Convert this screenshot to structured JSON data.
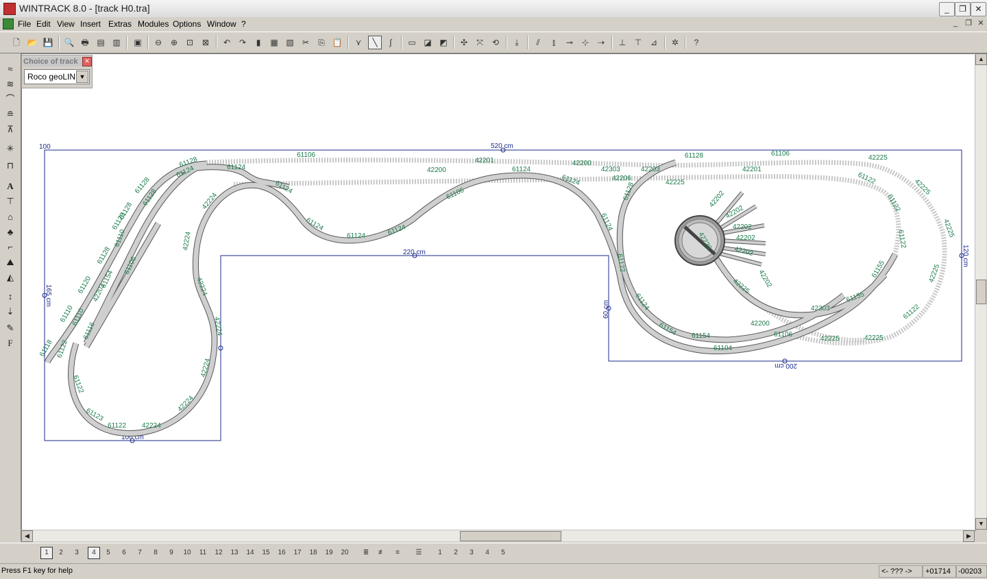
{
  "window": {
    "title": "WINTRACK 8.0 - [track H0.tra]",
    "buttons": {
      "minimize": "_",
      "restore": "❐",
      "close": "✕"
    }
  },
  "menu": {
    "items": [
      "File",
      "Edit",
      "View",
      "Insert",
      "Extras",
      "Modules",
      "Options",
      "Window",
      "?"
    ],
    "mdi": {
      "minimize": "_",
      "restore": "❐",
      "close": "✕"
    }
  },
  "toolbar": {
    "icons": [
      "new-icon",
      "open-icon",
      "save-icon",
      "print-preview-icon",
      "print-icon",
      "print-setup-icon",
      "list-icon",
      "picture-icon",
      "zoom-out-icon",
      "zoom-in-icon",
      "zoom-window-icon",
      "zoom-all-icon",
      "undo-icon",
      "redo-icon",
      "book-icon",
      "copy-module-icon",
      "paste-module-icon",
      "cut-icon",
      "copy-icon",
      "paste-icon",
      "turnout-icon",
      "straight-icon",
      "curve-icon",
      "ruler-icon",
      "layer-up-icon",
      "layer-down-icon",
      "rotate-icon",
      "move-icon",
      "rotate-180-icon",
      "connect-icon",
      "split-icon",
      "track-rise-icon",
      "join-icon",
      "align-icon",
      "height-icon",
      "height2-icon",
      "height3-icon",
      "snap-icon",
      "help-pointer-icon"
    ]
  },
  "choice_of_track": {
    "title": "Choice of track",
    "close": "✕",
    "selected": "Roco geoLINE"
  },
  "layers": {
    "numbers": [
      "1",
      "2",
      "3",
      "4",
      "5",
      "6",
      "7",
      "8",
      "9",
      "10",
      "11",
      "12",
      "13",
      "14",
      "15",
      "16",
      "17",
      "18",
      "19",
      "20"
    ],
    "active": [
      "1",
      "4"
    ],
    "views": [
      "1",
      "2",
      "3",
      "4",
      "5"
    ]
  },
  "layout": {
    "dimensions": {
      "top": "520 cm",
      "corner": "100",
      "left": "165 cm",
      "inner_step": "220 cm",
      "bottom_left": "100 cm",
      "inner_vertical": "60 cm",
      "bottom_right": "200 cm",
      "right": "120 cm"
    },
    "track_labels": [
      "61106",
      "42201",
      "42200",
      "42303",
      "42203",
      "61128",
      "61106",
      "42225",
      "42201",
      "61124",
      "61124",
      "42200",
      "42206",
      "42225",
      "61106",
      "61124",
      "61124",
      "61124",
      "61128",
      "61124",
      "61128",
      "61122",
      "42225",
      "61122",
      "42225",
      "42224",
      "42224",
      "42224",
      "42224",
      "42224",
      "42224",
      "42224",
      "61122",
      "61122",
      "61120",
      "61110",
      "61118",
      "61128",
      "61129",
      "42202",
      "42202",
      "42202",
      "42202",
      "42202",
      "42226",
      "42202",
      "42225",
      "42303",
      "61155",
      "61155",
      "61154",
      "61154",
      "61104",
      "42200",
      "61106",
      "42225",
      "42225",
      "61122",
      "61122",
      "42225",
      "61110",
      "61106",
      "61154",
      "42203",
      "61124",
      "61110",
      "61116",
      "61124",
      "61128",
      "61124",
      "61122",
      "61123",
      "61122",
      "61124",
      "61128",
      "61128"
    ]
  },
  "statusbar": {
    "help": "Press F1 key for help",
    "nav": "<- ??? ->",
    "x": "+01714",
    "y": "-00203"
  }
}
